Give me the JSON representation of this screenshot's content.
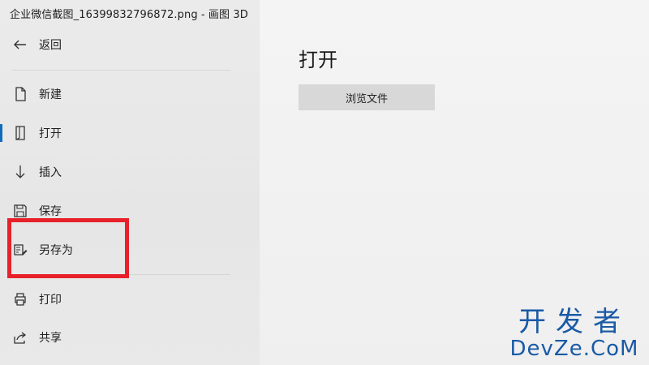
{
  "window": {
    "title": "企业微信截图_16399832796872.png - 画图 3D"
  },
  "sidebar": {
    "back": {
      "label": "返回",
      "icon": "back-arrow-icon"
    },
    "items": [
      {
        "id": "new",
        "label": "新建",
        "icon": "new-file-icon"
      },
      {
        "id": "open",
        "label": "打开",
        "icon": "open-file-icon",
        "active": true
      },
      {
        "id": "insert",
        "label": "插入",
        "icon": "insert-arrow-icon"
      },
      {
        "id": "save",
        "label": "保存",
        "icon": "save-icon"
      },
      {
        "id": "save-as",
        "label": "另存为",
        "icon": "save-as-icon"
      },
      {
        "id": "print",
        "label": "打印",
        "icon": "printer-icon"
      },
      {
        "id": "share",
        "label": "共享",
        "icon": "share-icon"
      }
    ]
  },
  "main": {
    "title": "打开",
    "browse_button_label": "浏览文件"
  },
  "watermark": {
    "chinese": "开发者",
    "latin": "DevZe.CoM"
  },
  "colors": {
    "accent": "#0f6cbd",
    "highlight": "#e8202a",
    "watermark": "#1a5aa6"
  }
}
